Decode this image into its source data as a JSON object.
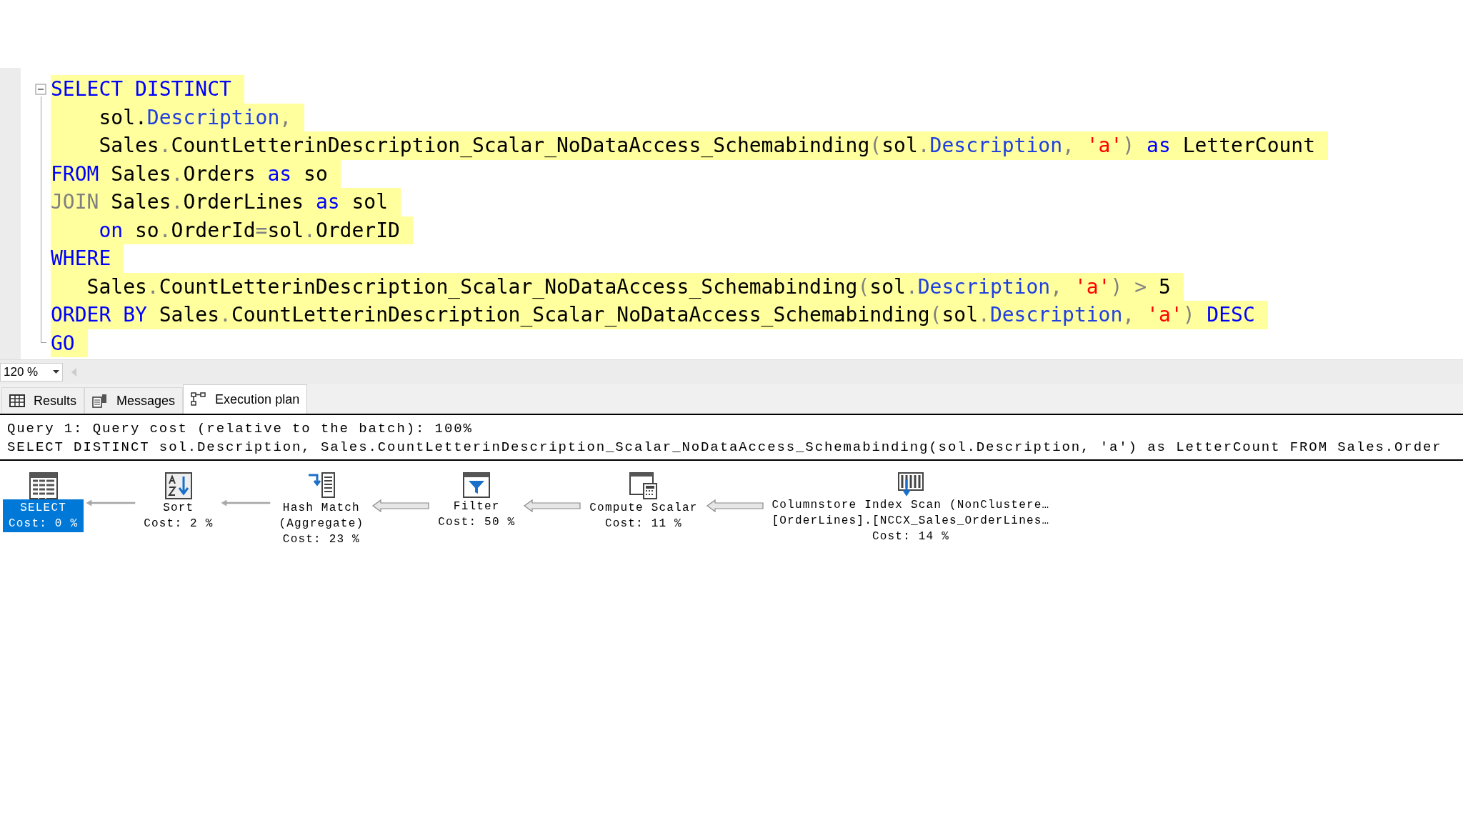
{
  "editor": {
    "lines": [
      {
        "tokens": [
          {
            "kind": "keyword",
            "text": "SELECT DISTINCT"
          }
        ]
      },
      {
        "tokens": [
          {
            "kind": "plain",
            "text": "    sol."
          },
          {
            "kind": "member",
            "text": "Description"
          },
          {
            "kind": "operator",
            "text": ","
          }
        ]
      },
      {
        "tokens": [
          {
            "kind": "plain",
            "text": "    Sales"
          },
          {
            "kind": "operator",
            "text": "."
          },
          {
            "kind": "plain",
            "text": "CountLetterinDescription_Scalar_NoDataAccess_Schemabinding"
          },
          {
            "kind": "operator",
            "text": "("
          },
          {
            "kind": "plain",
            "text": "sol"
          },
          {
            "kind": "operator",
            "text": "."
          },
          {
            "kind": "member",
            "text": "Description"
          },
          {
            "kind": "operator",
            "text": ", "
          },
          {
            "kind": "string",
            "text": "'a'"
          },
          {
            "kind": "operator",
            "text": ") "
          },
          {
            "kind": "keyword",
            "text": "as"
          },
          {
            "kind": "plain",
            "text": " LetterCount"
          }
        ]
      },
      {
        "tokens": [
          {
            "kind": "keyword",
            "text": "FROM"
          },
          {
            "kind": "plain",
            "text": " Sales"
          },
          {
            "kind": "operator",
            "text": "."
          },
          {
            "kind": "plain",
            "text": "Orders "
          },
          {
            "kind": "keyword",
            "text": "as"
          },
          {
            "kind": "plain",
            "text": " so"
          }
        ]
      },
      {
        "tokens": [
          {
            "kind": "operator",
            "text": "JOIN"
          },
          {
            "kind": "plain",
            "text": " Sales"
          },
          {
            "kind": "operator",
            "text": "."
          },
          {
            "kind": "plain",
            "text": "OrderLines "
          },
          {
            "kind": "keyword",
            "text": "as"
          },
          {
            "kind": "plain",
            "text": " sol"
          }
        ]
      },
      {
        "tokens": [
          {
            "kind": "keyword",
            "text": "    on"
          },
          {
            "kind": "plain",
            "text": " so"
          },
          {
            "kind": "operator",
            "text": "."
          },
          {
            "kind": "plain",
            "text": "OrderId"
          },
          {
            "kind": "operator",
            "text": "="
          },
          {
            "kind": "plain",
            "text": "sol"
          },
          {
            "kind": "operator",
            "text": "."
          },
          {
            "kind": "plain",
            "text": "OrderID"
          }
        ]
      },
      {
        "tokens": [
          {
            "kind": "keyword",
            "text": "WHERE"
          }
        ]
      },
      {
        "tokens": [
          {
            "kind": "plain",
            "text": "   Sales"
          },
          {
            "kind": "operator",
            "text": "."
          },
          {
            "kind": "plain",
            "text": "CountLetterinDescription_Scalar_NoDataAccess_Schemabinding"
          },
          {
            "kind": "operator",
            "text": "("
          },
          {
            "kind": "plain",
            "text": "sol"
          },
          {
            "kind": "operator",
            "text": "."
          },
          {
            "kind": "member",
            "text": "Description"
          },
          {
            "kind": "operator",
            "text": ", "
          },
          {
            "kind": "string",
            "text": "'a'"
          },
          {
            "kind": "operator",
            "text": ") > "
          },
          {
            "kind": "plain",
            "text": "5"
          }
        ]
      },
      {
        "tokens": [
          {
            "kind": "keyword",
            "text": "ORDER BY"
          },
          {
            "kind": "plain",
            "text": " Sales"
          },
          {
            "kind": "operator",
            "text": "."
          },
          {
            "kind": "plain",
            "text": "CountLetterinDescription_Scalar_NoDataAccess_Schemabinding"
          },
          {
            "kind": "operator",
            "text": "("
          },
          {
            "kind": "plain",
            "text": "sol"
          },
          {
            "kind": "operator",
            "text": "."
          },
          {
            "kind": "member",
            "text": "Description"
          },
          {
            "kind": "operator",
            "text": ", "
          },
          {
            "kind": "string",
            "text": "'a'"
          },
          {
            "kind": "operator",
            "text": ") "
          },
          {
            "kind": "keyword",
            "text": "DESC"
          }
        ]
      },
      {
        "tokens": [
          {
            "kind": "keyword",
            "text": "GO"
          }
        ]
      }
    ]
  },
  "zoom": {
    "value": "120 %"
  },
  "tabs": [
    {
      "label": "Results",
      "selected": false
    },
    {
      "label": "Messages",
      "selected": false
    },
    {
      "label": "Execution plan",
      "selected": true
    }
  ],
  "plan_header": [
    "Query 1: Query cost (relative to the batch): 100%",
    "SELECT DISTINCT sol.Description, Sales.CountLetterinDescription_Scalar_NoDataAccess_Schemabinding(sol.Description, 'a') as LetterCount FROM Sales.Order"
  ],
  "plan_nodes": [
    {
      "kind": "select",
      "selected": true,
      "lines": [
        "SELECT",
        "Cost: 0 %"
      ]
    },
    {
      "kind": "sort",
      "selected": false,
      "lines": [
        "Sort",
        "Cost: 2 %"
      ]
    },
    {
      "kind": "hash",
      "selected": false,
      "lines": [
        "Hash Match",
        "(Aggregate)",
        "Cost: 23 %"
      ]
    },
    {
      "kind": "filter",
      "selected": false,
      "lines": [
        "Filter",
        "Cost: 50 %"
      ]
    },
    {
      "kind": "compute",
      "selected": false,
      "lines": [
        "Compute Scalar",
        "Cost: 11 %"
      ]
    },
    {
      "kind": "scan",
      "selected": false,
      "lines": [
        "Columnstore Index Scan (NonClustere…",
        "[OrderLines].[NCCX_Sales_OrderLines…",
        "Cost: 14 %"
      ]
    }
  ]
}
